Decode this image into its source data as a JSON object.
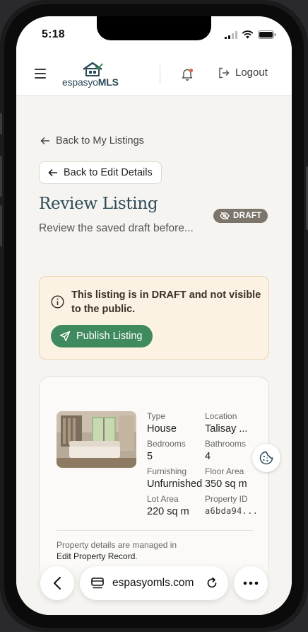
{
  "status_bar": {
    "time": "5:18"
  },
  "header": {
    "logo_text_light": "espasyo",
    "logo_text_bold": "MLS",
    "logout_label": "Logout"
  },
  "nav": {
    "back_to_listings": "Back to My Listings",
    "back_to_edit": "Back to Edit Details"
  },
  "page": {
    "title": "Review Listing",
    "subtitle": "Review the saved draft before...",
    "status_badge": "DRAFT"
  },
  "alert": {
    "message": "This listing is in DRAFT and not visible to the public.",
    "publish_label": "Publish Listing"
  },
  "property": {
    "fields": [
      {
        "label": "Type",
        "value": "House"
      },
      {
        "label": "Location",
        "value": "Talisay ..."
      },
      {
        "label": "Bedrooms",
        "value": "5"
      },
      {
        "label": "Bathrooms",
        "value": "4"
      },
      {
        "label": "Furnishing",
        "value": "Unfurnished"
      },
      {
        "label": "Floor Area",
        "value": "350 sq m"
      },
      {
        "label": "Lot Area",
        "value": "220 sq m"
      },
      {
        "label": "Property ID",
        "value": "a6bda94..."
      }
    ],
    "note_prefix": "Property details are managed in",
    "note_link": "Edit Property Record",
    "note_suffix": "."
  },
  "browser": {
    "url": "espasyomls.com"
  },
  "colors": {
    "brand_navy": "#2d4a58",
    "publish_green": "#3f8a5e",
    "alert_bg": "#fcf2e3",
    "badge_gray": "#7b756b",
    "notification_dot": "#d8684a"
  }
}
